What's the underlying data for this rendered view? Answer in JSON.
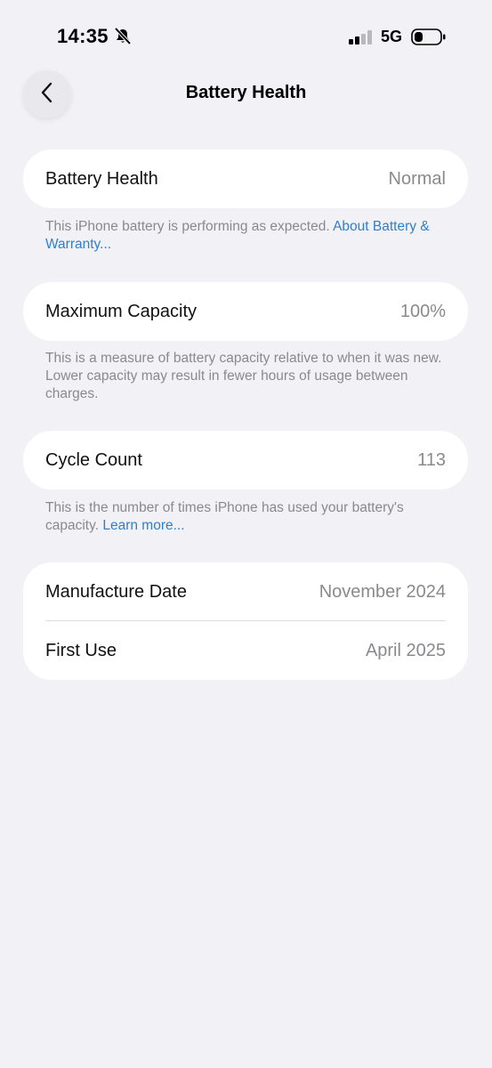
{
  "status_bar": {
    "time": "14:35",
    "network": "5G"
  },
  "header": {
    "title": "Battery Health"
  },
  "battery_health": {
    "label": "Battery Health",
    "value": "Normal",
    "footnote": "This iPhone battery is performing as expected.",
    "footnote_link": "About Battery & Warranty..."
  },
  "maximum_capacity": {
    "label": "Maximum Capacity",
    "value": "100%",
    "footnote": "This is a measure of battery capacity relative to when it was new. Lower capacity may result in fewer hours of usage between charges."
  },
  "cycle_count": {
    "label": "Cycle Count",
    "value": "113",
    "footnote": "This is the number of times iPhone has used your battery's capacity.",
    "footnote_link": "Learn more..."
  },
  "dates": {
    "manufacture_label": "Manufacture Date",
    "manufacture_value": "November 2024",
    "first_use_label": "First Use",
    "first_use_value": "April 2025"
  }
}
